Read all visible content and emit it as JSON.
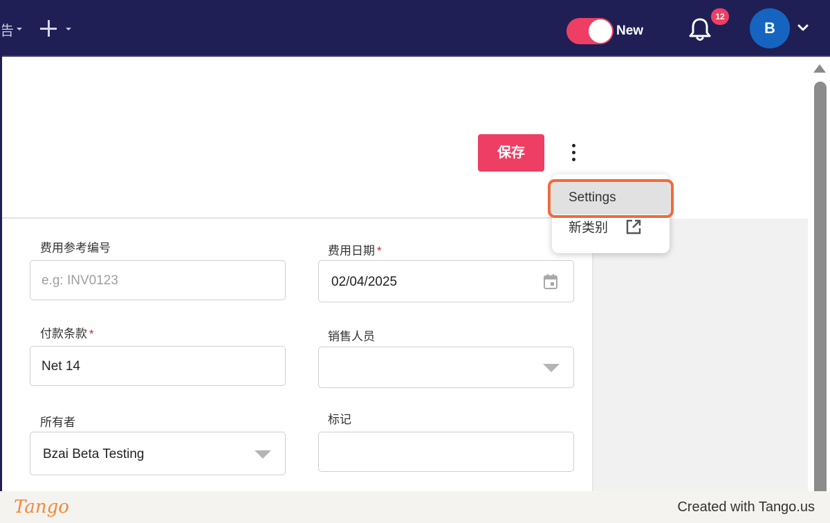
{
  "topbar": {
    "nav_fragment": "告",
    "toggle_label": "New",
    "notification_count": "12",
    "avatar_initial": "B"
  },
  "toolbar": {
    "save_label": "保存"
  },
  "menu": {
    "items": [
      {
        "label": "Settings"
      },
      {
        "label": "新类别"
      }
    ]
  },
  "form": {
    "fields": [
      {
        "label": "费用参考编号",
        "required": false,
        "placeholder": "e.g: INV0123",
        "value": ""
      },
      {
        "label": "费用日期",
        "required": true,
        "placeholder": "",
        "value": "02/04/2025"
      },
      {
        "label": "付款条款",
        "required": true,
        "placeholder": "",
        "value": "Net 14"
      },
      {
        "label": "销售人员",
        "required": false,
        "placeholder": "",
        "value": ""
      },
      {
        "label": "所有者",
        "required": false,
        "placeholder": "",
        "value": "Bzai Beta Testing"
      },
      {
        "label": "标记",
        "required": false,
        "placeholder": "",
        "value": ""
      }
    ],
    "required_mark": "*"
  },
  "footer": {
    "logo_text": "Tango",
    "created_text": "Created with Tango.us"
  },
  "colors": {
    "topbar": "#1f1f55",
    "accent": "#ee3e63",
    "highlight": "#f06a3a",
    "avatar": "#1565c0"
  },
  "icons": {
    "plus": "plus-icon",
    "bell": "bell-icon",
    "calendar": "calendar-icon",
    "external_link": "external-link-icon",
    "kebab": "more-vertical-icon"
  }
}
